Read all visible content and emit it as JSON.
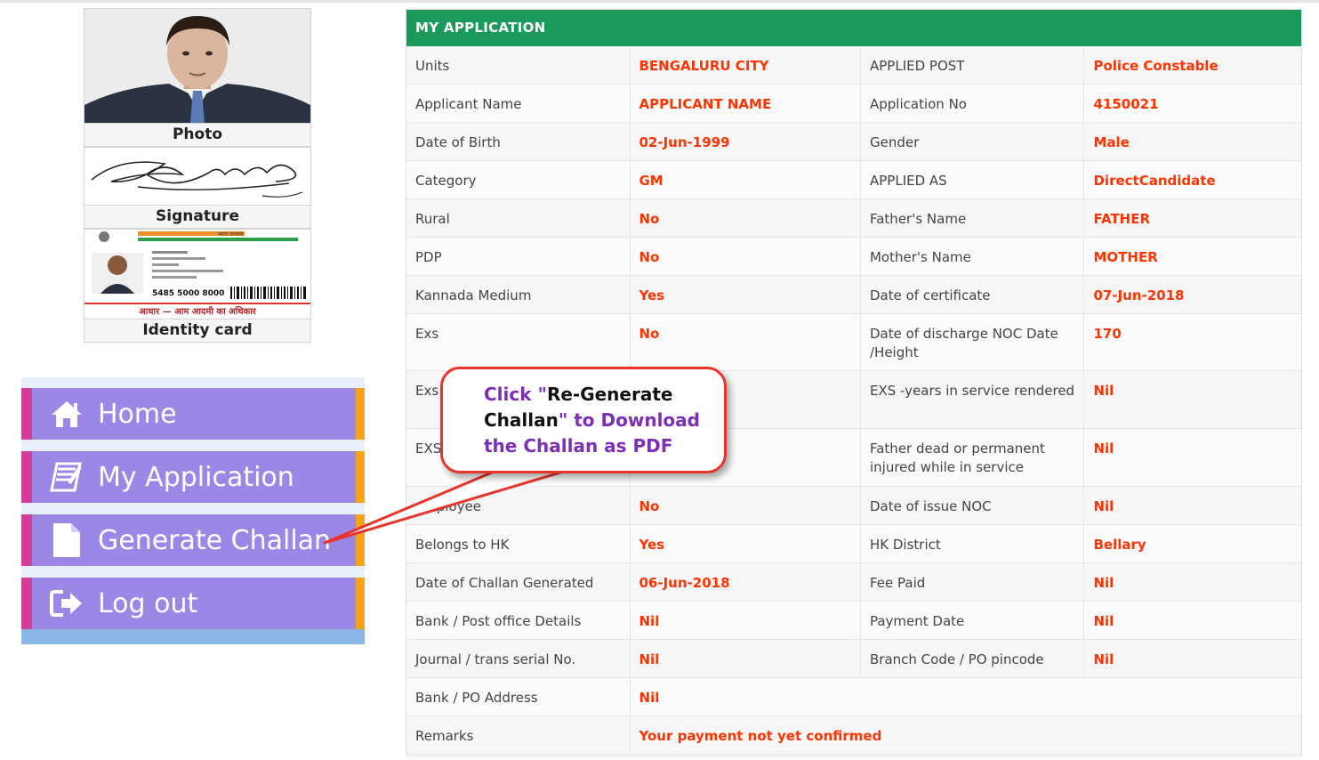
{
  "profile": {
    "photo_caption": "Photo",
    "signature_caption": "Signature",
    "id_caption": "Identity card",
    "id_card_number": "5485 5000 8000",
    "id_card_tagline": "आधार — आम आदमी का अधिकार",
    "id_card_header": "भारत सरकार"
  },
  "menu": {
    "items": [
      {
        "label": "Home",
        "icon": "home-icon"
      },
      {
        "label": "My Application",
        "icon": "edit-document-icon"
      },
      {
        "label": "Generate Challan",
        "icon": "file-icon"
      },
      {
        "label": "Log out",
        "icon": "logout-icon"
      }
    ]
  },
  "application": {
    "header": "MY APPLICATION",
    "rows": [
      {
        "l1": "Units",
        "v1": "BENGALURU CITY",
        "l2": "APPLIED POST",
        "v2": "Police Constable"
      },
      {
        "l1": "Applicant Name",
        "v1": "APPLICANT NAME",
        "l2": "Application No",
        "v2": "4150021"
      },
      {
        "l1": "Date of Birth",
        "v1": "02-Jun-1999",
        "l2": "Gender",
        "v2": "Male"
      },
      {
        "l1": "Category",
        "v1": "GM",
        "l2": "APPLIED AS",
        "v2": "DirectCandidate"
      },
      {
        "l1": "Rural",
        "v1": "No",
        "l2": "Father's Name",
        "v2": "FATHER"
      },
      {
        "l1": "PDP",
        "v1": "No",
        "l2": "Mother's Name",
        "v2": "MOTHER"
      },
      {
        "l1": "Kannada Medium",
        "v1": "Yes",
        "l2": "Date of certificate",
        "v2": "07-Jun-2018"
      },
      {
        "l1": "Exs",
        "v1": "No",
        "l2": "Date of discharge NOC Date /Height",
        "v2": "170"
      },
      {
        "l1": "Exs ser",
        "v1": "",
        "l2": "EXS -years in service rendered",
        "v2": "Nil"
      },
      {
        "l1": "EXS",
        "v1": "",
        "l2": "Father dead or permanent injured while in service",
        "v2": "Nil"
      },
      {
        "l1": "employee",
        "v1": "No",
        "l2": "Date of issue NOC",
        "v2": "Nil"
      },
      {
        "l1": "Belongs to HK",
        "v1": "Yes",
        "l2": "HK District",
        "v2": "Bellary"
      },
      {
        "l1": "Date of Challan Generated",
        "v1": "06-Jun-2018",
        "l2": "Fee Paid",
        "v2": "Nil"
      },
      {
        "l1": "Bank / Post office Details",
        "v1": "Nil",
        "l2": "Payment Date",
        "v2": "Nil"
      },
      {
        "l1": "Journal / trans serial No.",
        "v1": "Nil",
        "l2": "Branch Code / PO pincode",
        "v2": "Nil"
      }
    ],
    "wide_rows": [
      {
        "l1": "Bank / PO Address",
        "v1": "Nil"
      },
      {
        "l1": "Remarks",
        "v1": "Your payment not yet confirmed"
      }
    ]
  },
  "callout": {
    "line1_a": "Click \"",
    "line1_b": "Re-Generate",
    "line2_b": "Challan",
    "line2_a": "\" to Download",
    "line3": "the Challan as PDF"
  },
  "colors": {
    "header_green": "#199a5a",
    "value_red": "#ff3300",
    "menu_purple": "#9c86e6",
    "menu_pink": "#d43d97",
    "menu_orange": "#f7a21b",
    "callout_border": "#e8342c"
  }
}
